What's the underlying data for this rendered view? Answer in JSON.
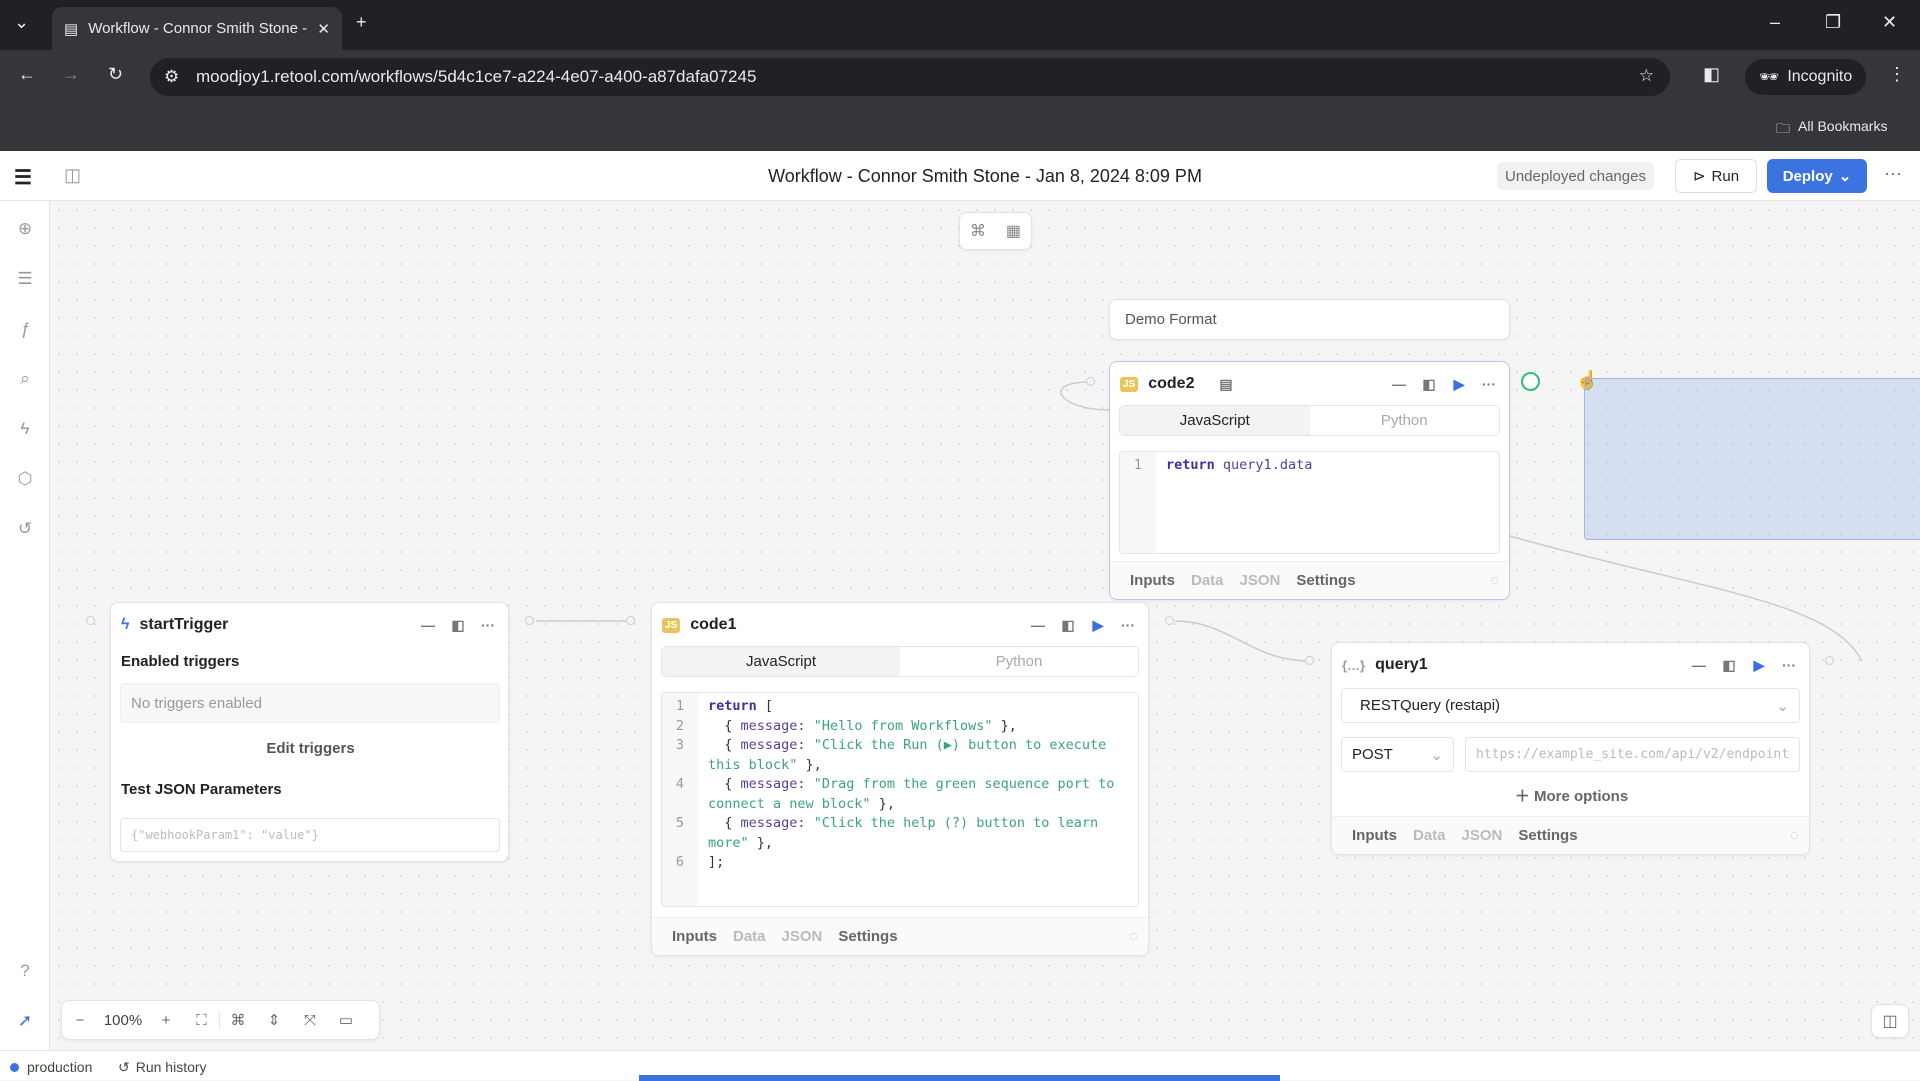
{
  "browser": {
    "tab_title": "Workflow - Connor Smith Stone - Jan 8, 2024 8:09 PM",
    "url": "moodjoy1.retool.com/workflows/5d4c1ce7-a224-4e07-a400-a87dafa07245",
    "incognito": "Incognito",
    "bookmarks": "All Bookmarks"
  },
  "header": {
    "title": "Workflow - Connor Smith Stone - Jan 8, 2024 8:09 PM",
    "undeployed": "Undeployed changes",
    "run": "Run",
    "deploy": "Deploy",
    "accent": "#3b73e0"
  },
  "note": {
    "text": "Demo Format"
  },
  "start_trigger": {
    "name": "startTrigger",
    "enabled_label": "Enabled triggers",
    "no_triggers": "No triggers enabled",
    "edit": "Edit triggers",
    "test_label": "Test JSON Parameters",
    "test_placeholder": "{\"webhookParam1\": \"value\"}"
  },
  "code1": {
    "name": "code1",
    "tabs": [
      "JavaScript",
      "Python"
    ],
    "lines": [
      "1",
      "2",
      "3",
      "4",
      "5",
      "6"
    ],
    "code": [
      {
        "k": "return",
        " ": " ["
      },
      {
        "p": "message:",
        "s": "\"Hello from Workflows\""
      },
      {
        "p": "message:",
        "s": "\"Click the Run (▶) button to execute this block\""
      },
      {
        "p": "message:",
        "s": "\"Drag from the green sequence port to connect a new block\""
      },
      {
        "p": "message:",
        "s": "\"Click the help (?) button to learn more\""
      },
      {
        "e": "];"
      }
    ],
    "footer": [
      "Inputs",
      "Data",
      "JSON",
      "Settings"
    ]
  },
  "code2": {
    "name": "code2",
    "tabs": [
      "JavaScript",
      "Python"
    ],
    "line": "1",
    "kw": "return",
    "expr": "query1.data",
    "footer": [
      "Inputs",
      "Data",
      "JSON",
      "Settings"
    ]
  },
  "query1": {
    "name": "query1",
    "resource": "RESTQuery (restapi)",
    "method": "POST",
    "url_placeholder": "https://example_site.com/api/v2/endpoint",
    "more": "More options",
    "footer": [
      "Inputs",
      "Data",
      "JSON",
      "Settings"
    ]
  },
  "toolbar": {
    "zoom": "100%"
  },
  "status": {
    "env": "production",
    "history": "Run history"
  }
}
